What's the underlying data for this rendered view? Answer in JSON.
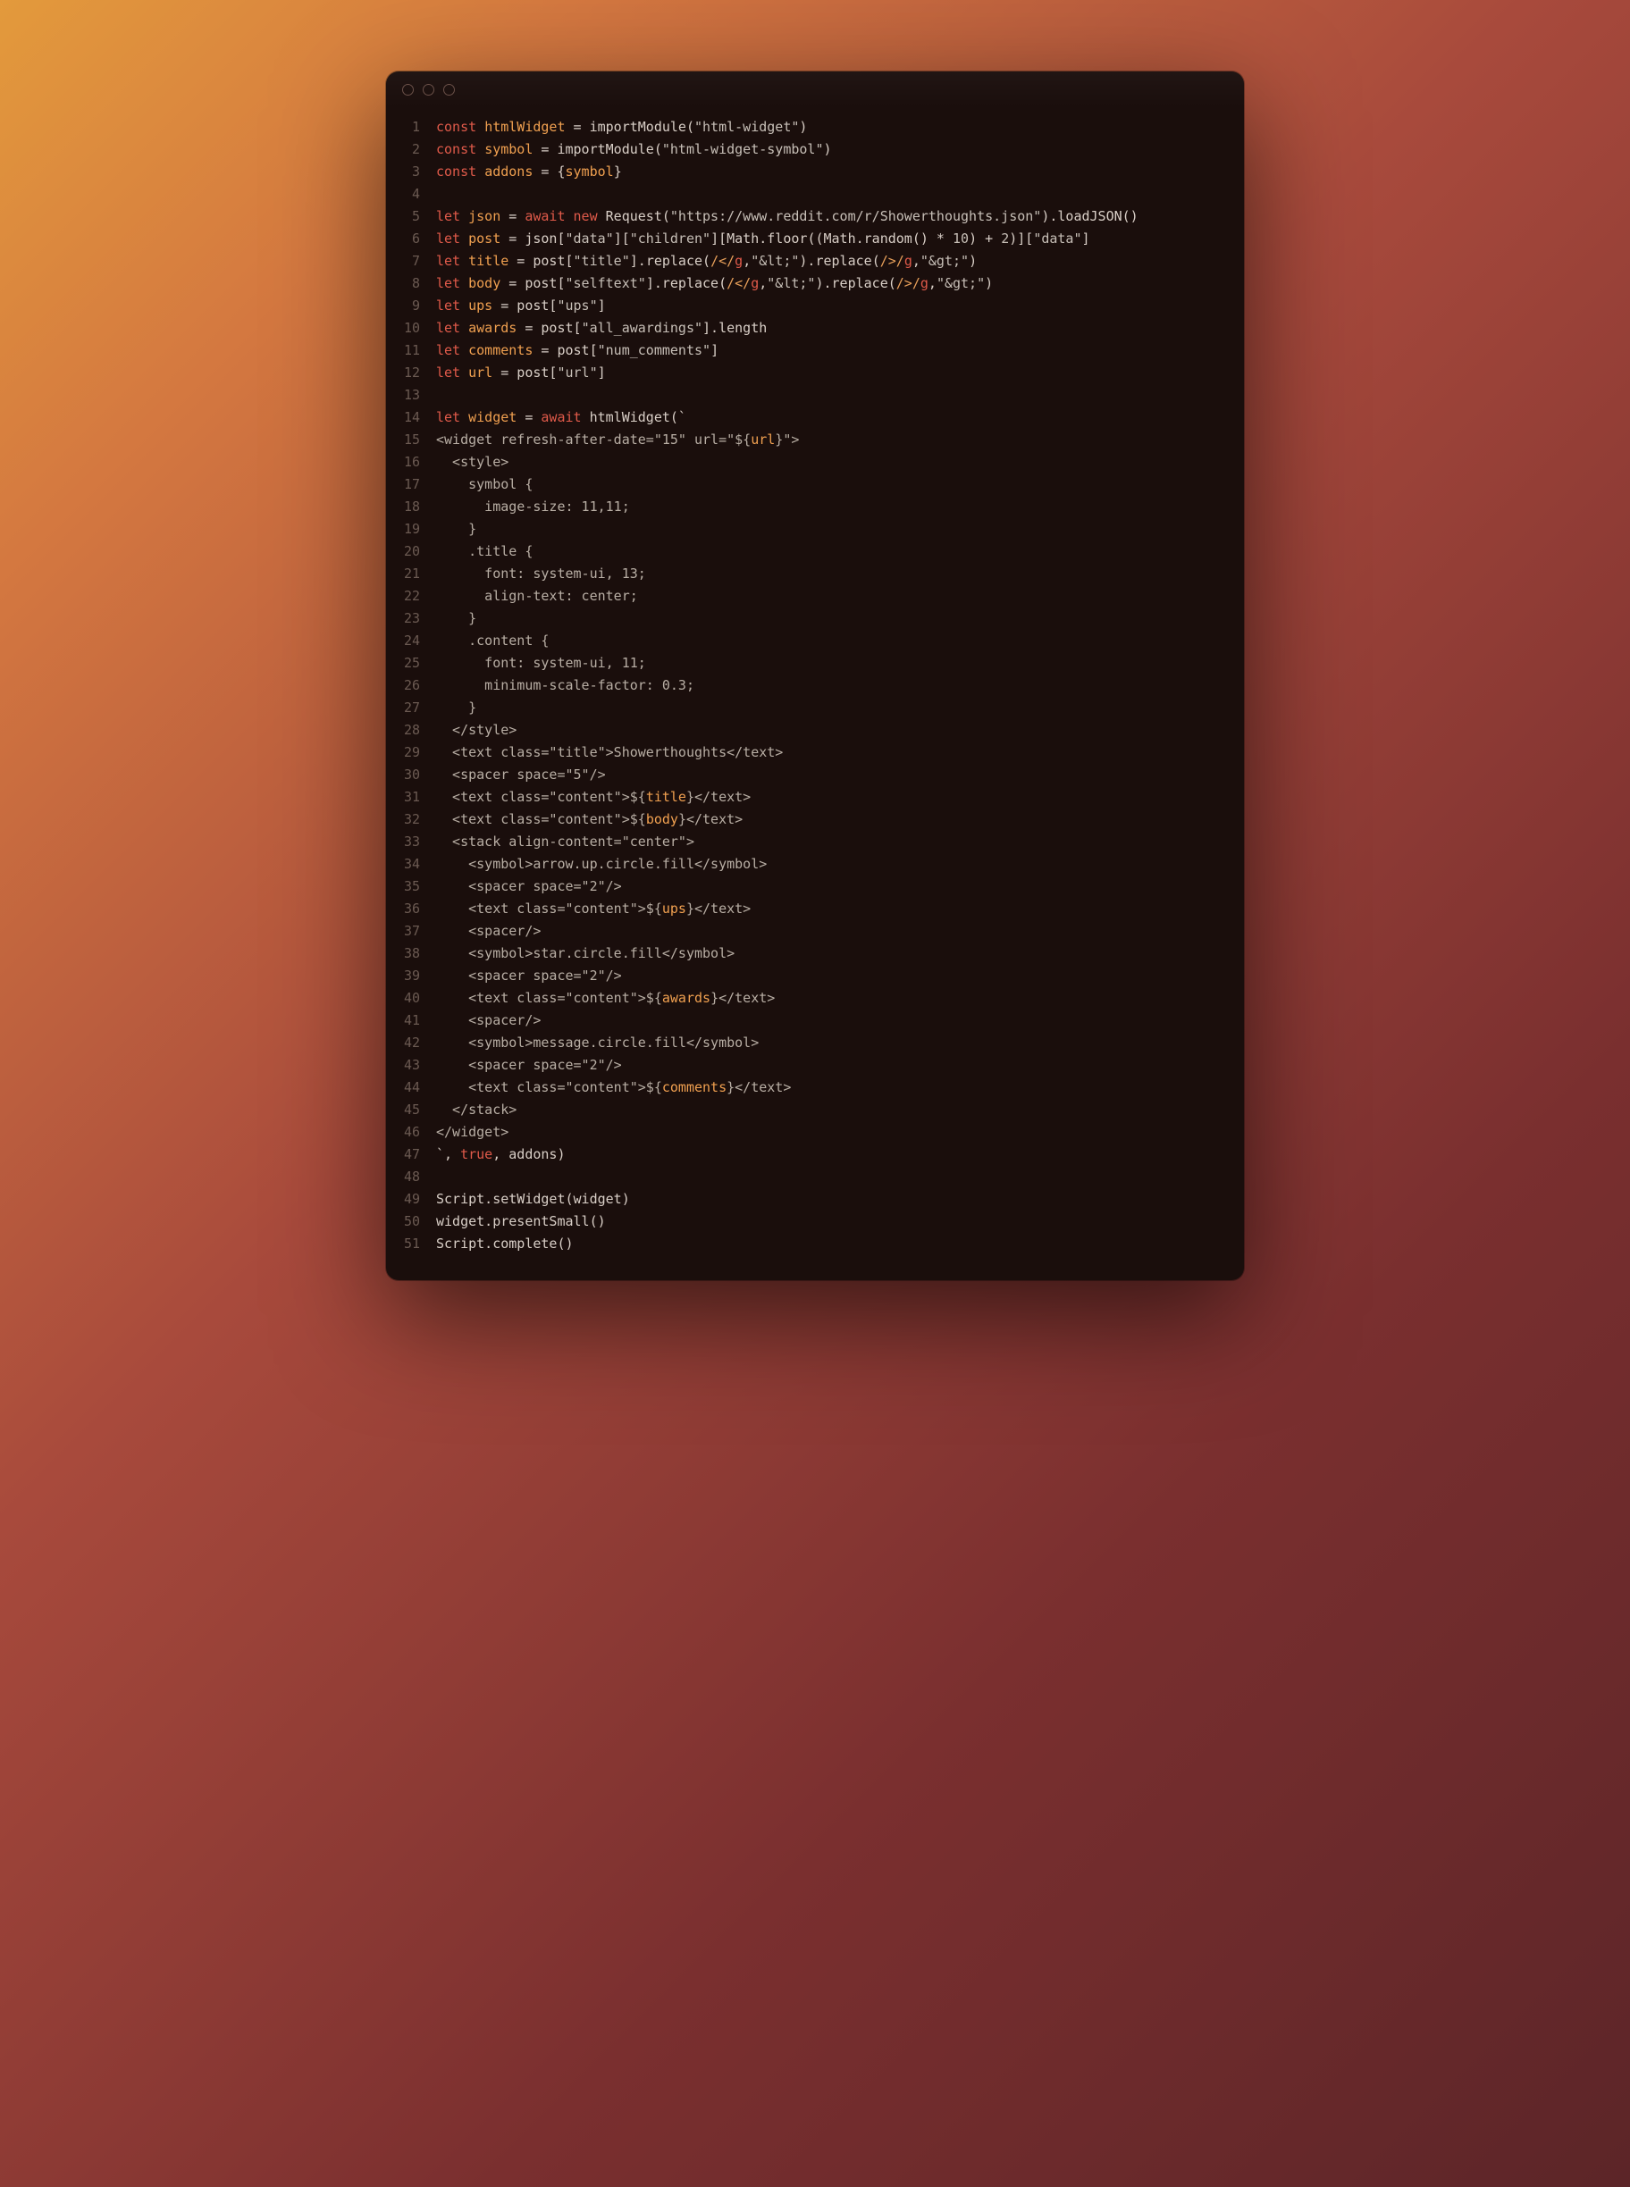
{
  "traffic_lights": [
    "close",
    "minimize",
    "zoom"
  ],
  "lines": [
    {
      "n": 1,
      "spans": [
        [
          "kw",
          "const "
        ],
        [
          "var",
          "htmlWidget"
        ],
        [
          "punc",
          " = "
        ],
        [
          "fn",
          "importModule"
        ],
        [
          "punc",
          "("
        ],
        [
          "str",
          "\"html-widget\""
        ],
        [
          "punc",
          ")"
        ]
      ]
    },
    {
      "n": 2,
      "spans": [
        [
          "kw",
          "const "
        ],
        [
          "var",
          "symbol"
        ],
        [
          "punc",
          " = "
        ],
        [
          "fn",
          "importModule"
        ],
        [
          "punc",
          "("
        ],
        [
          "str",
          "\"html-widget-symbol\""
        ],
        [
          "punc",
          ")"
        ]
      ]
    },
    {
      "n": 3,
      "spans": [
        [
          "kw",
          "const "
        ],
        [
          "var",
          "addons"
        ],
        [
          "punc",
          " = {"
        ],
        [
          "var",
          "symbol"
        ],
        [
          "punc",
          "}"
        ]
      ]
    },
    {
      "n": 4,
      "spans": []
    },
    {
      "n": 5,
      "spans": [
        [
          "kw",
          "let "
        ],
        [
          "var",
          "json"
        ],
        [
          "punc",
          " = "
        ],
        [
          "kw",
          "await new "
        ],
        [
          "fn",
          "Request"
        ],
        [
          "punc",
          "("
        ],
        [
          "str",
          "\"https://www.reddit.com/r/Showerthoughts.json\""
        ],
        [
          "punc",
          ")."
        ],
        [
          "fn",
          "loadJSON"
        ],
        [
          "punc",
          "()"
        ]
      ]
    },
    {
      "n": 6,
      "spans": [
        [
          "kw",
          "let "
        ],
        [
          "var",
          "post"
        ],
        [
          "punc",
          " = json["
        ],
        [
          "str",
          "\"data\""
        ],
        [
          "punc",
          "]["
        ],
        [
          "str",
          "\"children\""
        ],
        [
          "punc",
          "][Math."
        ],
        [
          "fn",
          "floor"
        ],
        [
          "punc",
          "((Math."
        ],
        [
          "fn",
          "random"
        ],
        [
          "punc",
          "() * "
        ],
        [
          "num",
          "10"
        ],
        [
          "punc",
          ") + "
        ],
        [
          "num",
          "2"
        ],
        [
          "punc",
          ")]["
        ],
        [
          "str",
          "\"data\""
        ],
        [
          "punc",
          "]"
        ]
      ]
    },
    {
      "n": 7,
      "spans": [
        [
          "kw",
          "let "
        ],
        [
          "var",
          "title"
        ],
        [
          "punc",
          " = post["
        ],
        [
          "str",
          "\"title\""
        ],
        [
          "punc",
          "]."
        ],
        [
          "fn",
          "replace"
        ],
        [
          "punc",
          "("
        ],
        [
          "re",
          "/</"
        ],
        [
          "kw",
          "g"
        ],
        [
          "punc",
          ","
        ],
        [
          "str",
          "\"&lt;\""
        ],
        [
          "punc",
          ")."
        ],
        [
          "fn",
          "replace"
        ],
        [
          "punc",
          "("
        ],
        [
          "re",
          "/>/"
        ],
        [
          "kw",
          "g"
        ],
        [
          "punc",
          ","
        ],
        [
          "str",
          "\"&gt;\""
        ],
        [
          "punc",
          ")"
        ]
      ]
    },
    {
      "n": 8,
      "spans": [
        [
          "kw",
          "let "
        ],
        [
          "var",
          "body"
        ],
        [
          "punc",
          " = post["
        ],
        [
          "str",
          "\"selftext\""
        ],
        [
          "punc",
          "]."
        ],
        [
          "fn",
          "replace"
        ],
        [
          "punc",
          "("
        ],
        [
          "re",
          "/</"
        ],
        [
          "kw",
          "g"
        ],
        [
          "punc",
          ","
        ],
        [
          "str",
          "\"&lt;\""
        ],
        [
          "punc",
          ")."
        ],
        [
          "fn",
          "replace"
        ],
        [
          "punc",
          "("
        ],
        [
          "re",
          "/>/"
        ],
        [
          "kw",
          "g"
        ],
        [
          "punc",
          ","
        ],
        [
          "str",
          "\"&gt;\""
        ],
        [
          "punc",
          ")"
        ]
      ]
    },
    {
      "n": 9,
      "spans": [
        [
          "kw",
          "let "
        ],
        [
          "var",
          "ups"
        ],
        [
          "punc",
          " = post["
        ],
        [
          "str",
          "\"ups\""
        ],
        [
          "punc",
          "]"
        ]
      ]
    },
    {
      "n": 10,
      "spans": [
        [
          "kw",
          "let "
        ],
        [
          "var",
          "awards"
        ],
        [
          "punc",
          " = post["
        ],
        [
          "str",
          "\"all_awardings\""
        ],
        [
          "punc",
          "].length"
        ]
      ]
    },
    {
      "n": 11,
      "spans": [
        [
          "kw",
          "let "
        ],
        [
          "var",
          "comments"
        ],
        [
          "punc",
          " = post["
        ],
        [
          "str",
          "\"num_comments\""
        ],
        [
          "punc",
          "]"
        ]
      ]
    },
    {
      "n": 12,
      "spans": [
        [
          "kw",
          "let "
        ],
        [
          "var",
          "url"
        ],
        [
          "punc",
          " = post["
        ],
        [
          "str",
          "\"url\""
        ],
        [
          "punc",
          "]"
        ]
      ]
    },
    {
      "n": 13,
      "spans": []
    },
    {
      "n": 14,
      "spans": [
        [
          "kw",
          "let "
        ],
        [
          "var",
          "widget"
        ],
        [
          "punc",
          " = "
        ],
        [
          "kw",
          "await "
        ],
        [
          "fn",
          "htmlWidget"
        ],
        [
          "punc",
          "(`"
        ]
      ]
    },
    {
      "n": 15,
      "spans": [
        [
          "dim",
          "<widget refresh-after-date=\"15\" url=\"${"
        ],
        [
          "var",
          "url"
        ],
        [
          "dim",
          "}\">"
        ]
      ]
    },
    {
      "n": 16,
      "spans": [
        [
          "dim",
          "  <style>"
        ]
      ]
    },
    {
      "n": 17,
      "spans": [
        [
          "dim",
          "    symbol {"
        ]
      ]
    },
    {
      "n": 18,
      "spans": [
        [
          "dim",
          "      image-size: 11,11;"
        ]
      ]
    },
    {
      "n": 19,
      "spans": [
        [
          "dim",
          "    }"
        ]
      ]
    },
    {
      "n": 20,
      "spans": [
        [
          "dim",
          "    .title {"
        ]
      ]
    },
    {
      "n": 21,
      "spans": [
        [
          "dim",
          "      font: system-ui, 13;"
        ]
      ]
    },
    {
      "n": 22,
      "spans": [
        [
          "dim",
          "      align-text: center;"
        ]
      ]
    },
    {
      "n": 23,
      "spans": [
        [
          "dim",
          "    }"
        ]
      ]
    },
    {
      "n": 24,
      "spans": [
        [
          "dim",
          "    .content {"
        ]
      ]
    },
    {
      "n": 25,
      "spans": [
        [
          "dim",
          "      font: system-ui, 11;"
        ]
      ]
    },
    {
      "n": 26,
      "spans": [
        [
          "dim",
          "      minimum-scale-factor: 0.3;"
        ]
      ]
    },
    {
      "n": 27,
      "spans": [
        [
          "dim",
          "    }"
        ]
      ]
    },
    {
      "n": 28,
      "spans": [
        [
          "dim",
          "  </style>"
        ]
      ]
    },
    {
      "n": 29,
      "spans": [
        [
          "dim",
          "  <text class=\"title\">Showerthoughts</text>"
        ]
      ]
    },
    {
      "n": 30,
      "spans": [
        [
          "dim",
          "  <spacer space=\"5\"/>"
        ]
      ]
    },
    {
      "n": 31,
      "spans": [
        [
          "dim",
          "  <text class=\"content\">${"
        ],
        [
          "var",
          "title"
        ],
        [
          "dim",
          "}</text>"
        ]
      ]
    },
    {
      "n": 32,
      "spans": [
        [
          "dim",
          "  <text class=\"content\">${"
        ],
        [
          "var",
          "body"
        ],
        [
          "dim",
          "}</text>"
        ]
      ]
    },
    {
      "n": 33,
      "spans": [
        [
          "dim",
          "  <stack align-content=\"center\">"
        ]
      ]
    },
    {
      "n": 34,
      "spans": [
        [
          "dim",
          "    <symbol>arrow.up.circle.fill</symbol>"
        ]
      ]
    },
    {
      "n": 35,
      "spans": [
        [
          "dim",
          "    <spacer space=\"2\"/>"
        ]
      ]
    },
    {
      "n": 36,
      "spans": [
        [
          "dim",
          "    <text class=\"content\">${"
        ],
        [
          "var",
          "ups"
        ],
        [
          "dim",
          "}</text>"
        ]
      ]
    },
    {
      "n": 37,
      "spans": [
        [
          "dim",
          "    <spacer/>"
        ]
      ]
    },
    {
      "n": 38,
      "spans": [
        [
          "dim",
          "    <symbol>star.circle.fill</symbol>"
        ]
      ]
    },
    {
      "n": 39,
      "spans": [
        [
          "dim",
          "    <spacer space=\"2\"/>"
        ]
      ]
    },
    {
      "n": 40,
      "spans": [
        [
          "dim",
          "    <text class=\"content\">${"
        ],
        [
          "var",
          "awards"
        ],
        [
          "dim",
          "}</text>"
        ]
      ]
    },
    {
      "n": 41,
      "spans": [
        [
          "dim",
          "    <spacer/>"
        ]
      ]
    },
    {
      "n": 42,
      "spans": [
        [
          "dim",
          "    <symbol>message.circle.fill</symbol>"
        ]
      ]
    },
    {
      "n": 43,
      "spans": [
        [
          "dim",
          "    <spacer space=\"2\"/>"
        ]
      ]
    },
    {
      "n": 44,
      "spans": [
        [
          "dim",
          "    <text class=\"content\">${"
        ],
        [
          "var",
          "comments"
        ],
        [
          "dim",
          "}</text>"
        ]
      ]
    },
    {
      "n": 45,
      "spans": [
        [
          "dim",
          "  </stack>"
        ]
      ]
    },
    {
      "n": 46,
      "spans": [
        [
          "dim",
          "</widget>"
        ]
      ]
    },
    {
      "n": 47,
      "spans": [
        [
          "punc",
          "`, "
        ],
        [
          "bool",
          "true"
        ],
        [
          "punc",
          ", addons)"
        ]
      ]
    },
    {
      "n": 48,
      "spans": []
    },
    {
      "n": 49,
      "spans": [
        [
          "punc",
          "Script."
        ],
        [
          "fn",
          "setWidget"
        ],
        [
          "punc",
          "(widget)"
        ]
      ]
    },
    {
      "n": 50,
      "spans": [
        [
          "punc",
          "widget."
        ],
        [
          "fn",
          "presentSmall"
        ],
        [
          "punc",
          "()"
        ]
      ]
    },
    {
      "n": 51,
      "spans": [
        [
          "punc",
          "Script."
        ],
        [
          "fn",
          "complete"
        ],
        [
          "punc",
          "()"
        ]
      ]
    }
  ]
}
